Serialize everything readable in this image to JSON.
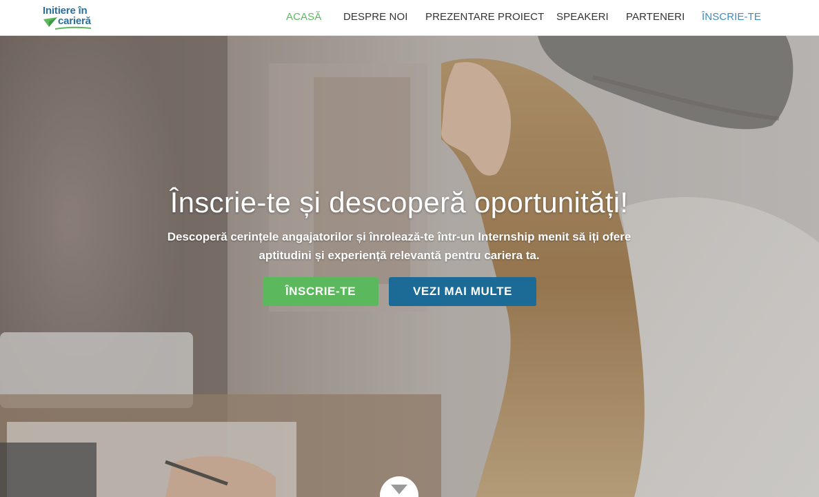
{
  "logo": {
    "line1": "Initiere în",
    "line2": "carieră",
    "brand_color": "#2c6e9c",
    "accent_color": "#5cb85c"
  },
  "nav": {
    "items": [
      {
        "label": "ACASĂ",
        "state": "active"
      },
      {
        "label": "DESPRE NOI"
      },
      {
        "label": "PREZENTARE PROIECT"
      },
      {
        "label": "SPEAKERI"
      },
      {
        "label": "PARTENERI"
      },
      {
        "label": "ÎNSCRIE-TE",
        "state": "highlight"
      }
    ]
  },
  "hero": {
    "title": "Înscrie-te și descoperă oportunități!",
    "subtitle_line1": "Descoperă cerințele angajatorilor și înrolează-te într-un Internship menit să iți ofere",
    "subtitle_line2": "aptitudini și experiență relevantă pentru cariera ta.",
    "primary_button": "ÎNSCRIE-TE",
    "secondary_button": "VEZI MAI MULTE",
    "scroll_icon": "chevron-down-icon"
  },
  "colors": {
    "green": "#5cb85c",
    "blue": "#1c6a96",
    "nav_highlight": "#3c8dbc",
    "nav_text": "#333333"
  }
}
